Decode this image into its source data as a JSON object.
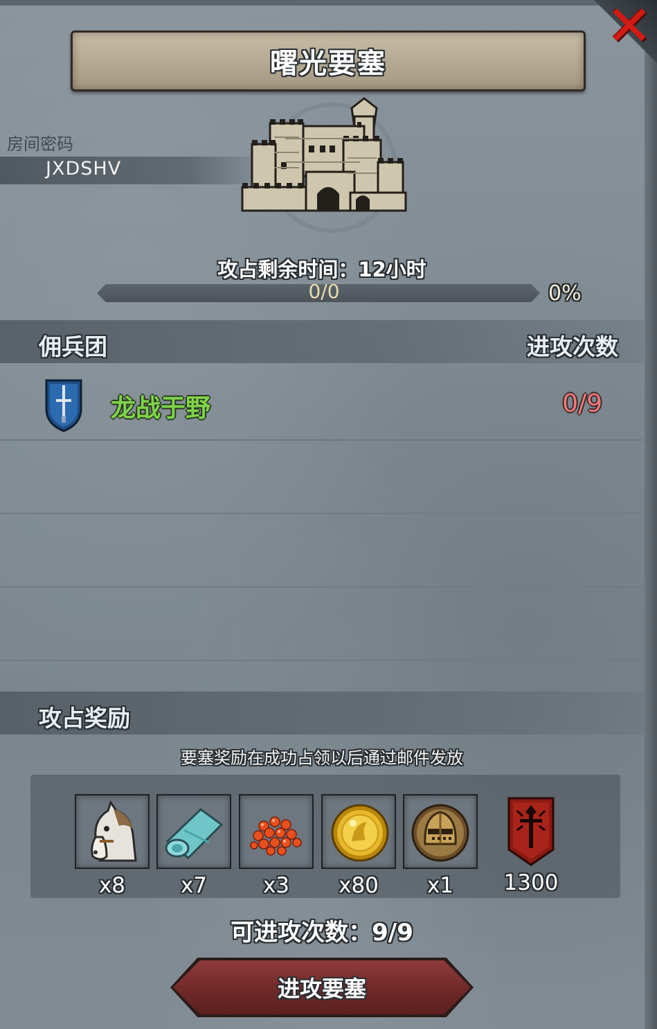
{
  "title": "曙光要塞",
  "room": {
    "label": "房间密码",
    "code": "JXDSHV"
  },
  "siege": {
    "time_label": "攻占剩余时间：12小时",
    "progress_text": "0/0",
    "progress_percent_text": "0%",
    "progress_fraction": 0
  },
  "mercenary": {
    "header": "佣兵团",
    "attacks_header": "进攻次数",
    "rows": [
      {
        "name": "龙战于野",
        "attacks": "0/9",
        "icon": "sword-shield-icon"
      }
    ]
  },
  "rewards": {
    "header": "攻占奖励",
    "note": "要塞奖励在成功占领以后通过邮件发放",
    "items": [
      {
        "icon": "horse-icon",
        "qty": "x8"
      },
      {
        "icon": "cloth-roll-icon",
        "qty": "x7"
      },
      {
        "icon": "red-gems-icon",
        "qty": "x3"
      },
      {
        "icon": "gold-coin-icon",
        "qty": "x80"
      },
      {
        "icon": "knight-helmet-icon",
        "qty": "x1"
      },
      {
        "icon": "glory-banner-icon",
        "qty": "1300"
      }
    ]
  },
  "attacks_left": "可进攻次数：9/9",
  "attack_button": "进攻要塞",
  "colors": {
    "merc_name": "#7fd34a",
    "attack_count": "#f0787a",
    "close": "#d11b14",
    "button": "#7a2f2e"
  }
}
